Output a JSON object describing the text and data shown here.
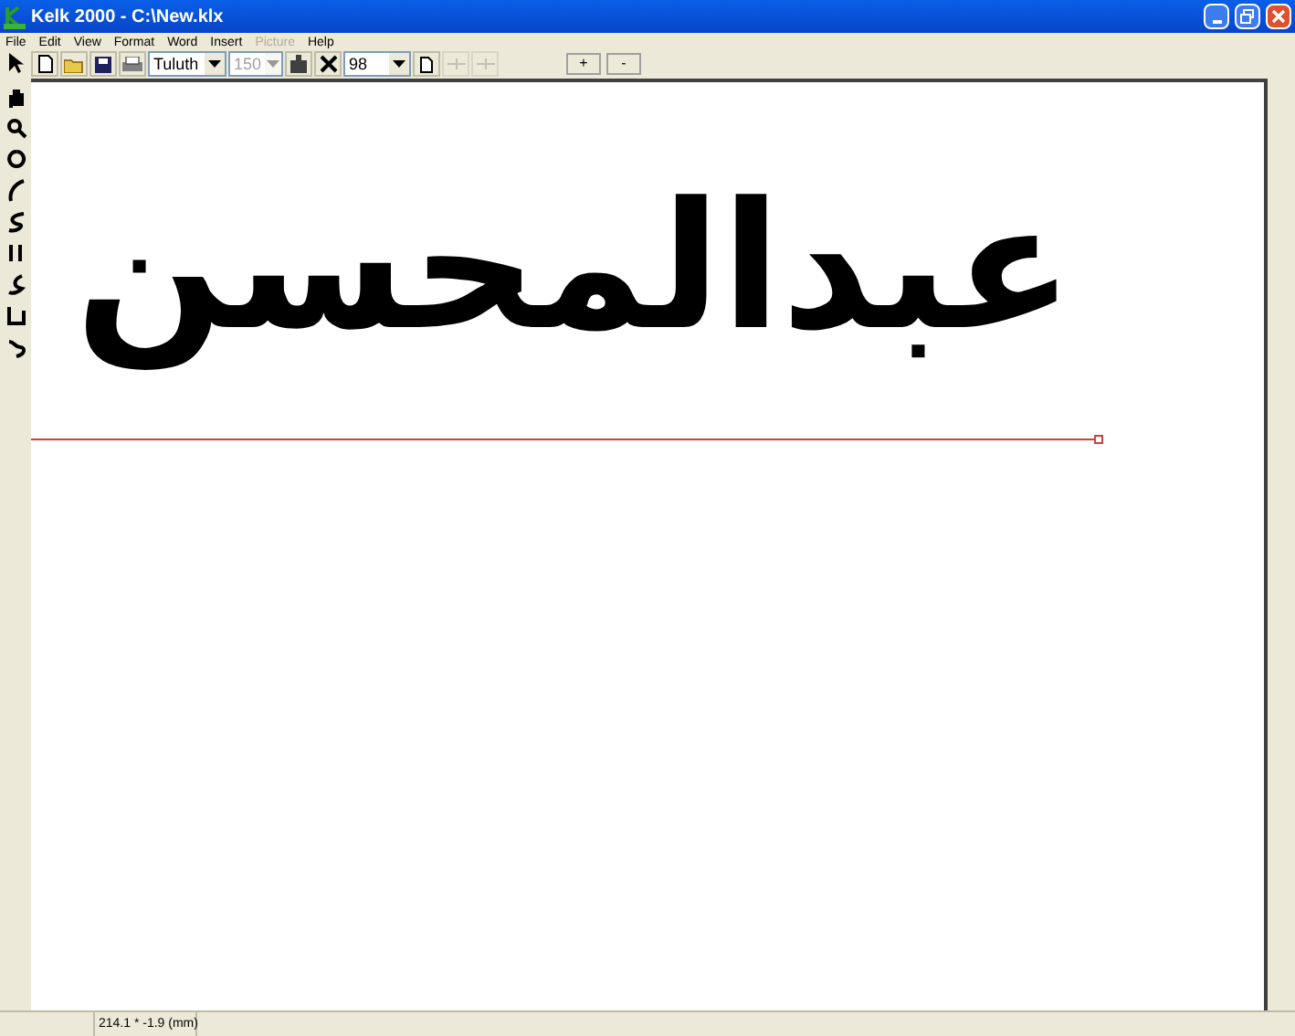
{
  "window": {
    "title": "Kelk 2000 - C:\\New.klx"
  },
  "menu": [
    {
      "label": "File",
      "disabled": false
    },
    {
      "label": "Edit",
      "disabled": false
    },
    {
      "label": "View",
      "disabled": false
    },
    {
      "label": "Format",
      "disabled": false
    },
    {
      "label": "Word",
      "disabled": false
    },
    {
      "label": "Insert",
      "disabled": false
    },
    {
      "label": "Picture",
      "disabled": true
    },
    {
      "label": "Help",
      "disabled": false
    }
  ],
  "toolbar": {
    "font": {
      "value": "Tuluth"
    },
    "size": {
      "value": "150",
      "disabled": true
    },
    "zoom": {
      "value": "98"
    },
    "plus": "+",
    "minus": "-"
  },
  "canvas": {
    "calligraphy": "عبدالمحسن"
  },
  "status_bar": {
    "position": "214.1 * -1.9 (mm)"
  }
}
